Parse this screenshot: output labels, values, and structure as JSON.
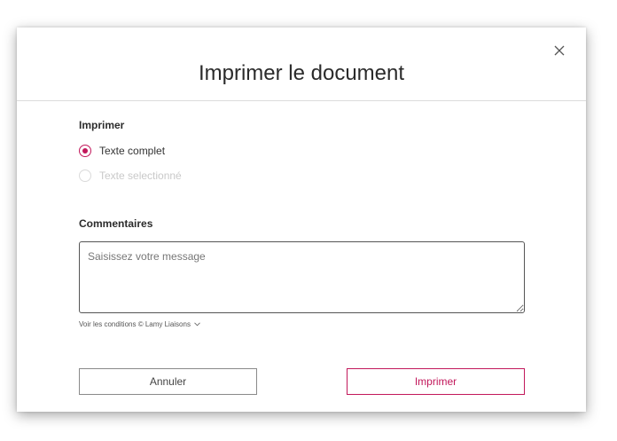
{
  "dialog": {
    "title": "Imprimer le document",
    "close_label": "×"
  },
  "print_section": {
    "label": "Imprimer",
    "options": [
      {
        "label": "Texte complet",
        "checked": true,
        "disabled": false
      },
      {
        "label": "Texte selectionné",
        "checked": false,
        "disabled": true
      }
    ]
  },
  "comments_section": {
    "label": "Commentaires",
    "placeholder": "Saisissez votre message",
    "value": ""
  },
  "conditions": {
    "link_text": "Voir les conditions © Lamy Liaisons"
  },
  "buttons": {
    "cancel_label": "Annuler",
    "print_label": "Imprimer"
  },
  "colors": {
    "accent": "#c2185b",
    "text": "#2b2b2b",
    "disabled": "#c9c9c9"
  }
}
